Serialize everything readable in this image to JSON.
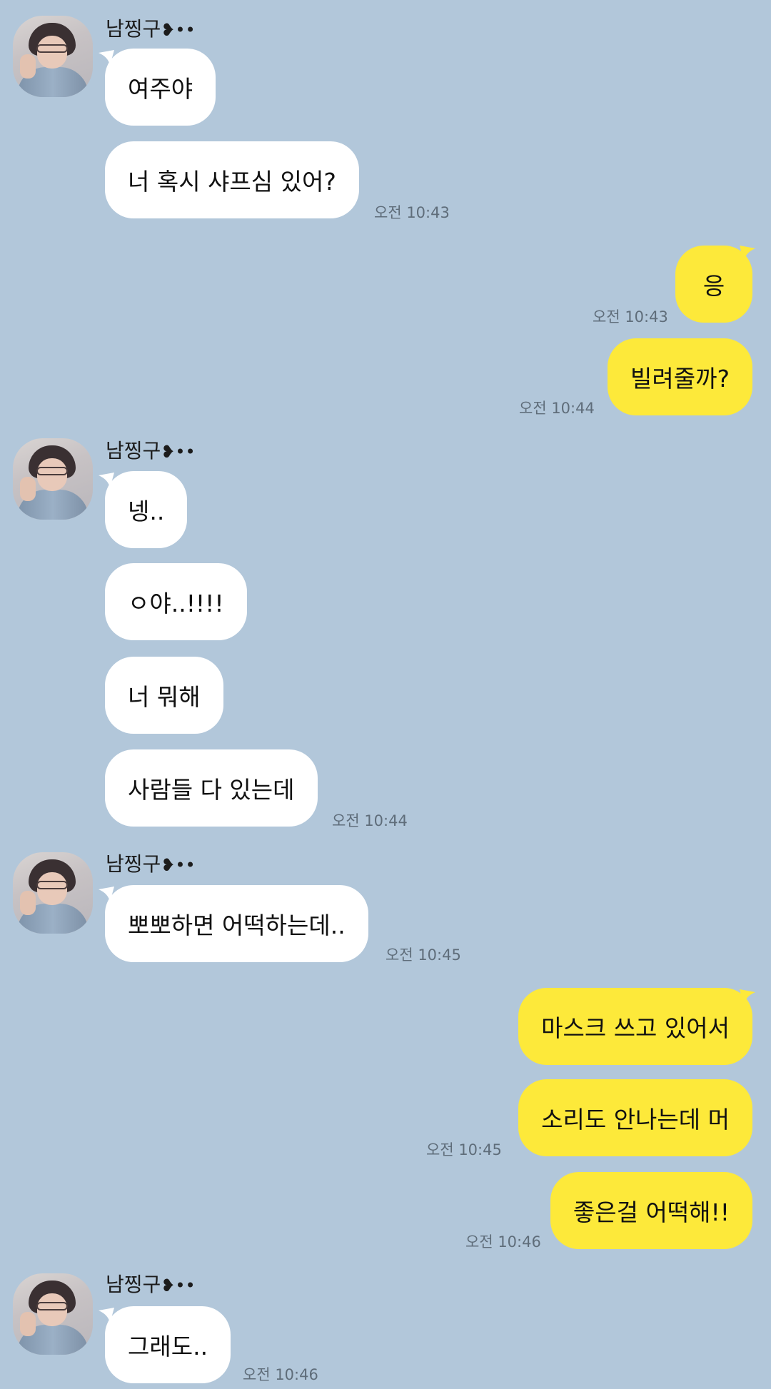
{
  "sender": {
    "name": "남찡구",
    "suffix": "❥••"
  },
  "groups": [
    {
      "messages": [
        "여주야",
        "너 혹시 샤프심 있어?"
      ],
      "time": "오전 10:43"
    },
    {
      "messages": [
        "응"
      ],
      "time": "오전 10:43"
    },
    {
      "messages": [
        "빌려줄까?"
      ],
      "time": "오전 10:44"
    },
    {
      "messages": [
        "넹..",
        "ㅇ야..!!!!",
        "너 뭐해",
        "사람들 다 있는데"
      ],
      "time": "오전 10:44"
    },
    {
      "messages": [
        "뽀뽀하면 어떡하는데.."
      ],
      "time": "오전 10:45"
    },
    {
      "messages": [
        "마스크 쓰고 있어서",
        "소리도 안나는데 머"
      ],
      "time": "오전 10:45"
    },
    {
      "messages": [
        "좋은걸 어떡해!!"
      ],
      "time": "오전 10:46"
    },
    {
      "messages": [
        "그래도.."
      ],
      "time": "오전 10:46"
    }
  ],
  "colors": {
    "background": "#b2c7da",
    "received_bubble": "#ffffff",
    "sent_bubble": "#fde93a",
    "timestamp": "#5f6d7a"
  },
  "icons": [
    "profile-avatar"
  ]
}
